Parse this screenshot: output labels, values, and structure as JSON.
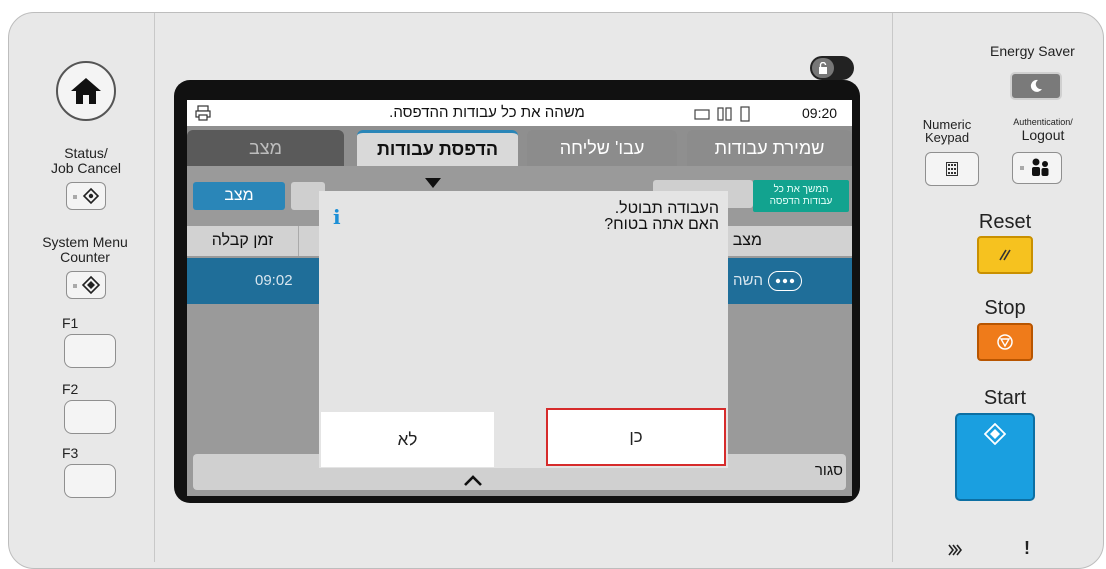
{
  "left_panel": {
    "home_icon": "home-icon",
    "status_label_line1": "Status/",
    "status_label_line2": "Job Cancel",
    "system_menu_line1": "System Menu",
    "system_menu_line2": "Counter",
    "f1": "F1",
    "f2": "F2",
    "f3": "F3"
  },
  "screen": {
    "title": "משהה את כל עבודות ההדפסה.",
    "time": "09:20",
    "tabs": {
      "status": "מצב",
      "print_jobs": "הדפסת עבודות",
      "send_jobs": "עבו' שליחה",
      "store_jobs": "שמירת עבודות"
    },
    "toolbar": {
      "status_button": "מצב",
      "resume_all_line1": "המשך את כל",
      "resume_all_line2": "עבודות הדפסה"
    },
    "table": {
      "col_status": "מצב",
      "col_received_time": "זמן קבלה",
      "row_time": "09:02",
      "row_status": "השה"
    },
    "close_label": "סגור"
  },
  "dialog": {
    "line1": "העבודה תבוטל.",
    "line2": "האם אתה בטוח?",
    "no_label": "לא",
    "yes_label": "כן"
  },
  "right_panel": {
    "energy_saver": "Energy Saver",
    "numeric_line1": "Numeric",
    "numeric_line2": "Keypad",
    "auth_line1": "Authentication/",
    "auth_line2": "Logout",
    "reset": "Reset",
    "stop": "Stop",
    "start": "Start"
  },
  "colors": {
    "tab_active": "#2a86b8",
    "tab_inactive": "#8c8c8c",
    "tab_dark": "#5a5a5a",
    "row_selected": "#1f6e99",
    "resume_button": "#12a38f",
    "yes_border": "#d62b2b",
    "reset_key": "#f6c21f",
    "stop_key": "#ef7b1a",
    "start_key": "#1a9fe0"
  }
}
